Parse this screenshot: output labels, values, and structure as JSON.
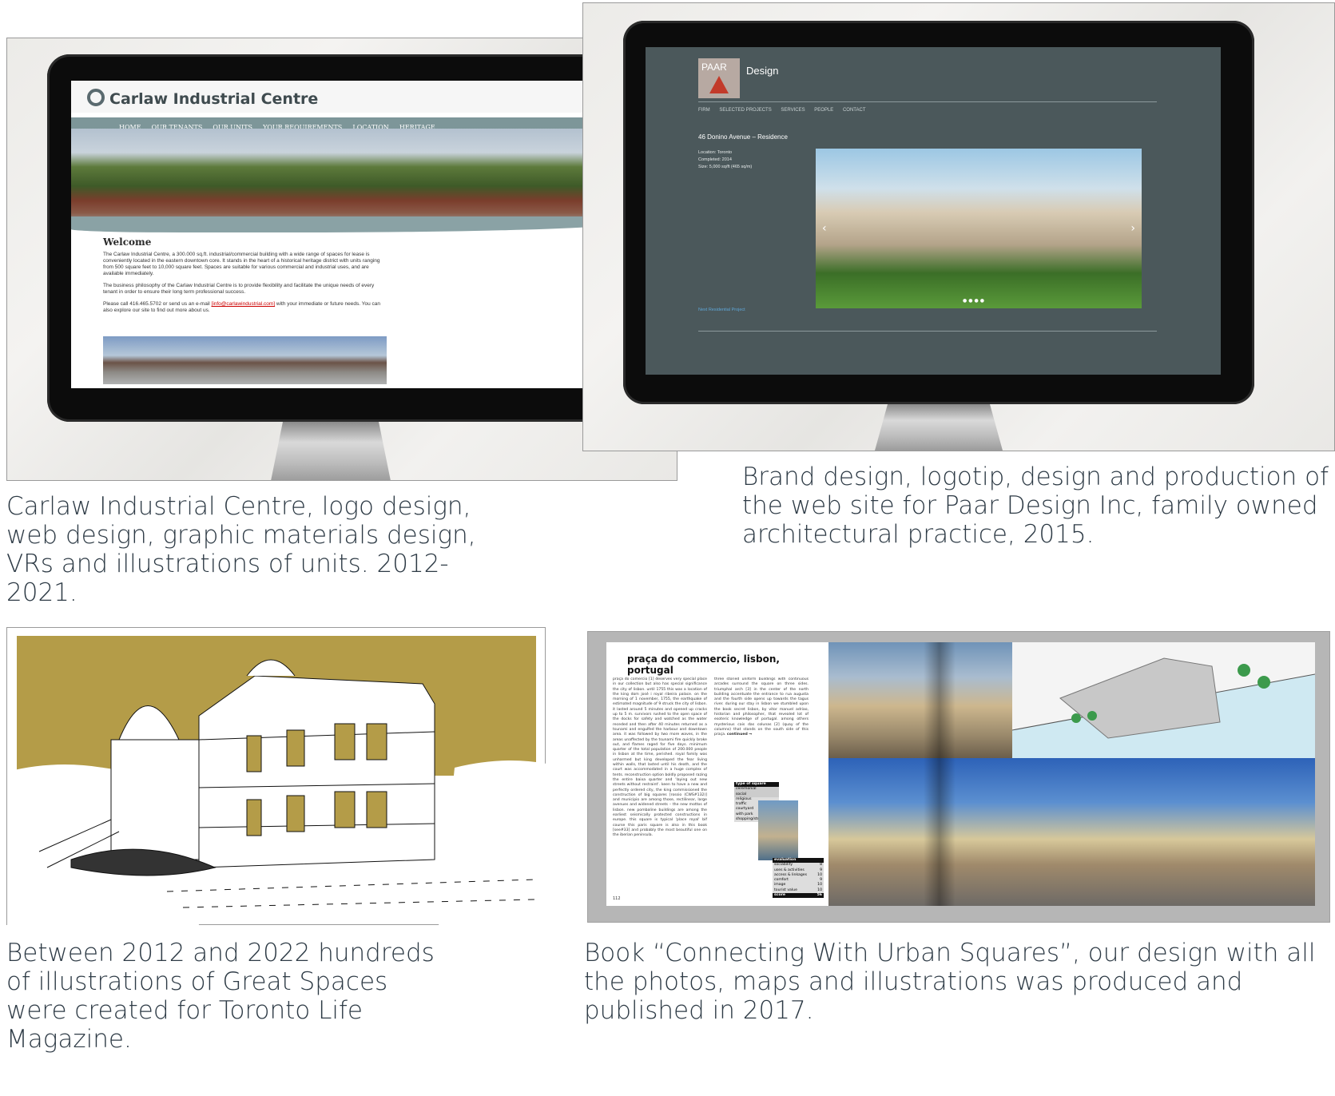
{
  "captions": {
    "carlaw": "Carlaw Industrial Centre, logo design, web design, graphic materials design, VRs and illustrations of units. 2012-2021.",
    "paar": "Brand design, logotip, design and production of the web site for Paar Design Inc, family owned architectural practice, 2015.",
    "illustrations": "Between 2012 and 2022 hundreds of illustrations of Great Spaces were created for Toronto Life Magazine.",
    "book": "Book “Connecting With Urban Squares”, our design with all the photos, maps and illustrations was produced and published in 2017."
  },
  "carlaw_site": {
    "logo_text": "Carlaw Industrial Centre",
    "nav": [
      "HOME",
      "OUR TENANTS",
      "OUR UNITS",
      "YOUR REQUIREMENTS",
      "LOCATION",
      "HERITAGE"
    ],
    "welcome_heading": "Welcome",
    "para1": "The Carlaw Industrial Centre, a 300.000 sq.ft. industrial/commercial building with a wide range of spaces for lease is conveniently located in the eastern downtown core. It stands in the heart of a historical heritage district with units ranging from 500 square feet to 10,000 square feet. Spaces are suitable for various commercial and industrial uses, and are available immediately.",
    "para2": "The business philosophy of the Carlaw Industrial Centre is to provide flexibility and facilitate the unique needs of every tenant in order to ensure their long term professional success.",
    "para3_before": "Please call 416.465.5702 or send us an e-mail",
    "email": "[info@carlawindustrial.com]",
    "para3_after": "with your immediate or future needs. You can also explore our site to find out more about us."
  },
  "paar_site": {
    "logo_text": "PAAR",
    "brand_word": "Design",
    "nav": [
      "FIRM",
      "SELECTED PROJECTS",
      "SERVICES",
      "PEOPLE",
      "CONTACT"
    ],
    "project_title": "46 Donino Avenue – Residence",
    "location": "Location: Toronto",
    "completed": "Completed: 2014",
    "size": "Size: 5,000 sq/ft (465 sq/m)",
    "next_link": "Next Residential Project",
    "prev_arrow": "‹",
    "next_arrow": "›",
    "dots": "●●●●"
  },
  "book": {
    "title": "praça do commercio, lisbon, portugal",
    "col1": "praça do comercio [1] deserves very special place in our collection but also has special significance the city of lisbon. until 1755 this was a location of the king dom josé i royal ribeira palace. on the morning of 1 november, 1755, the earthquake of estimated magnitude of 9 struck the city of lisbon. it lasted around 5 minutes and opened up cracks up to 5 m. survivors rushed to the open space of the docks for safety and watched as the water receded and then after 40 minutes returned as a tsunami and engulfed the harbour and downtown area. it was followed by two more waves, in the areas unaffected by the tsunami fire quickly broke out, and flames raged for five days. minimum quarter of the total population of 200.000 people in lisbon at the time, perished. royal family was unharmed but king developed the fear living within walls, that lasted until his death, and the court was accommodated in a huge complex of tents. reconstruction option boldly proposed razing the entire baixa quarter and 'laying out new streets without restraint'. keen to have a new and perfectly ordered city, the king commissioned the construction of big squares [rossio (CWS#132)] and municipio are among those, rectilinear, large avenues and widened streets – the new mottos of lisbon. new pombaline buildings are among the earliest seismically protected constructions in europe. this square is typical 'place royal' bif course this paris square is also in this book [see#33] and probably the most beautiful one on the iberian peninsula.",
    "col2": "three storied uniform buildings with continuous arcades surround the square on three sides. triumphal arch [3] in the center of the north building accentuate the entrance to rua augusta and the fourth side opens up towards the tagus river. during our stay in lisbon we stumbled upon the book secret lisbon, by vitor manuel adriao, historian and philosopher, that revealed lot of esoteric knowledge of portugal. among others mysterious cais das colunas [2] (quay of the columns) that stands on the south side of this praça.",
    "continued": "continued →",
    "table_header": "type of square",
    "table_rows": [
      "ceremonial",
      "social",
      "religious",
      "traffic",
      "courtyard",
      "with park",
      "shopping/street"
    ],
    "eval_header": "evaluation",
    "eval_rows": [
      {
        "label": "sociability",
        "value": "8"
      },
      {
        "label": "uses & activities",
        "value": "9"
      },
      {
        "label": "access & linkages",
        "value": "10"
      },
      {
        "label": "comfort",
        "value": "9"
      },
      {
        "label": "image",
        "value": "10"
      },
      {
        "label": "tourist value",
        "value": "10"
      }
    ],
    "score_label": "score",
    "score_value": "56",
    "page_number": "112"
  }
}
